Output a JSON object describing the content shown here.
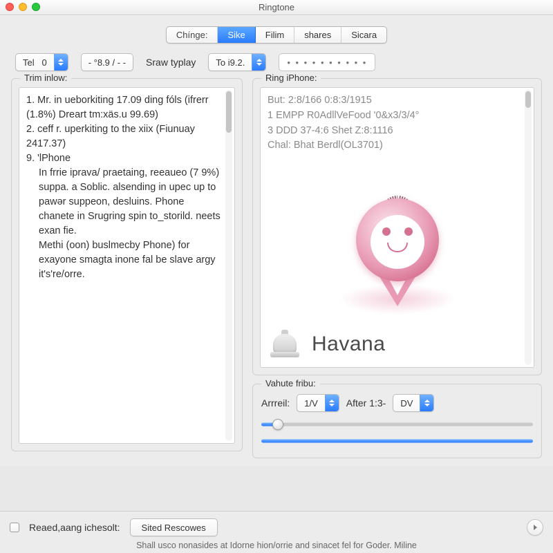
{
  "window": {
    "title": "Ringtone"
  },
  "tabs": {
    "label": "Chínge:",
    "items": [
      "Sike",
      "Filim",
      "shares",
      "Sicara"
    ],
    "selected": 0
  },
  "controls": {
    "tel": {
      "label": "Tel",
      "value": "0"
    },
    "range": "- °8.9 / - -",
    "spray": "Sraw typlay",
    "to": {
      "label": "To",
      "value": "i9.2."
    },
    "dots": "• • • • • • • • • •"
  },
  "left": {
    "title": "Trim inlow:",
    "lines": [
      "1. Mr. in ueborkiting 17.09 ding fóls (ifrerr (1.8%) Dreart tm:xäs.u 99.69)",
      "2. ceff r. uperkiting to the xiix (Fiunuay 2417.37)",
      "9. 'lPhone",
      "In frrie iprava/ praetaing, reeaueo (7 9%) suppa. a Soblic. alsending in upec up to pawər suppeon, desluins. Phone chanete in Srugring spin to_storild. neets exan fie.",
      "",
      "Methi (oon) buslmecby Phone) for exayone smagta inone fal be slave argy it's're/orre."
    ]
  },
  "right": {
    "title": "Ring iPhone:",
    "lines": [
      "But: 2:8/166 0:8:3/1915",
      "1 EMPP R0AdllVeFood '0&x3/3/4°",
      "3 DDD 37-4:6 Shet Z:8:1116",
      "Chal: Bhat Berdl(OL3701)"
    ],
    "brand": "Havana"
  },
  "volume": {
    "title": "Vahute fribu:",
    "arrrel": {
      "label": "Arrreil:",
      "value": "1/V"
    },
    "after": {
      "label": "After 1:3-",
      "value": "DV"
    }
  },
  "footer": {
    "check_label": "Reaed,aang ichesolt:",
    "button": "Sited Rescowes",
    "sub": "Shall usco nonasides at Idorne hion/orrie and sinacet fel for Goder. Miline"
  }
}
